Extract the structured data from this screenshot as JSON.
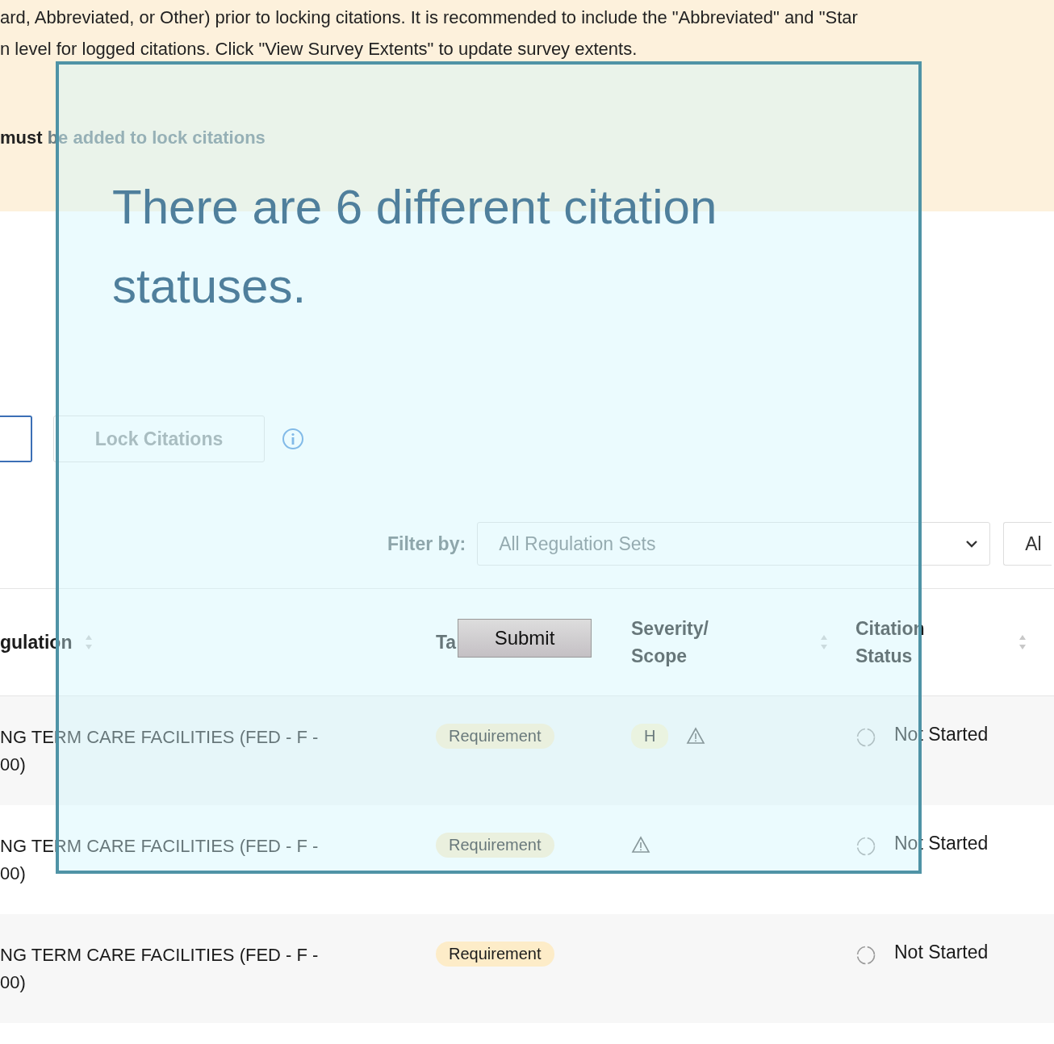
{
  "notice": {
    "lines": [
      "ard, Abbreviated, or Other) prior to locking citations. It is recommended to include the \"Abbreviated\" and \"Star",
      "n level for logged citations. Click \"View Survey Extents\" to update survey extents."
    ],
    "requirement": "**must** be added to lock citations"
  },
  "actions": {
    "lock_button": {
      "label": "Lock Citations",
      "disabled": true
    }
  },
  "filter": {
    "label": "Filter by:",
    "selects": [
      {
        "value": "All Regulation Sets"
      },
      {
        "value": "Al"
      }
    ]
  },
  "table": {
    "columns": [
      {
        "lines": [
          "gulation"
        ],
        "sortable": true
      },
      {
        "lines": [
          "Ta"
        ],
        "sortable": false
      },
      {
        "lines": [
          "Severity/",
          "Scope"
        ],
        "sortable": true
      },
      {
        "lines": [
          "Citation",
          "Status"
        ],
        "sortable": true
      }
    ],
    "rows": [
      {
        "regulation": [
          "NG TERM CARE FACILITIES (FED - F -",
          "00)"
        ],
        "tag": "Requirement",
        "severity": "H",
        "warning": true,
        "status": "Not Started"
      },
      {
        "regulation": [
          "NG TERM CARE FACILITIES (FED - F -",
          "00)"
        ],
        "tag": "Requirement",
        "warning": true,
        "status": "Not Started"
      },
      {
        "regulation": [
          "NG TERM CARE FACILITIES (FED - F -",
          "00)"
        ],
        "tag": "Requirement",
        "warning": false,
        "status": "Not Started"
      }
    ]
  },
  "tour": {
    "message": "There are 6 different citation statuses.",
    "button": "Submit"
  }
}
